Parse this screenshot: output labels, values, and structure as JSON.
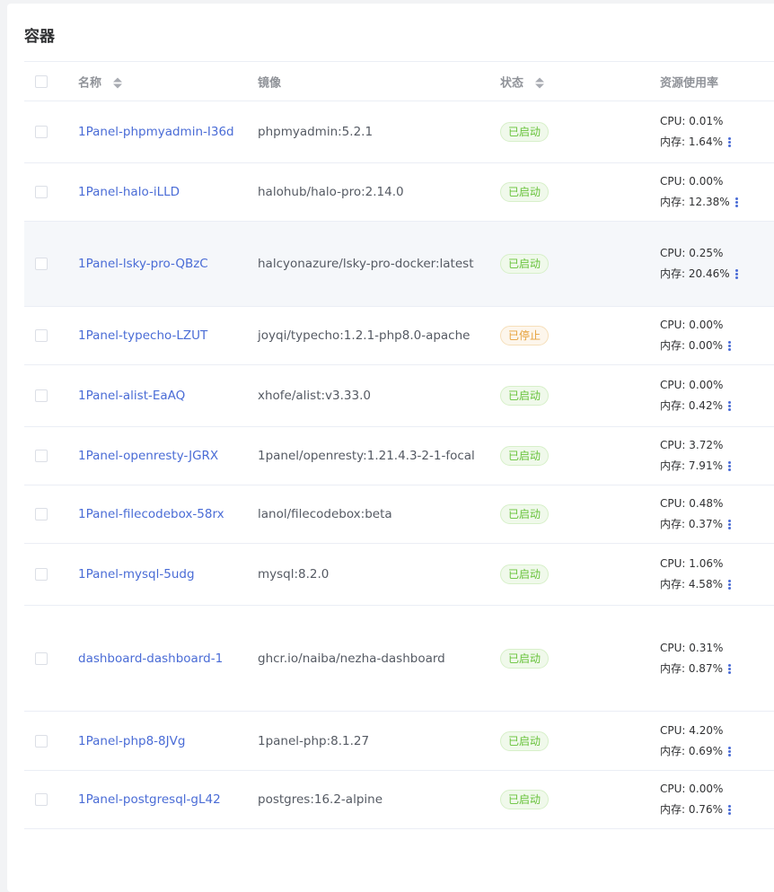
{
  "title": "容器",
  "columns": {
    "name": "名称",
    "image": "镜像",
    "status": "状态",
    "resource": "资源使用率"
  },
  "rows": [
    {
      "name": "1Panel-phpmyadmin-I36d",
      "image": "phpmyadmin:5.2.1",
      "status": "已启动",
      "status_type": "running",
      "cpu": "CPU: 0.01%",
      "mem": "内存: 1.64%"
    },
    {
      "name": "1Panel-halo-iLLD",
      "image": "halohub/halo-pro:2.14.0",
      "status": "已启动",
      "status_type": "running",
      "cpu": "CPU: 0.00%",
      "mem": "内存: 12.38%"
    },
    {
      "name": "1Panel-lsky-pro-QBzC",
      "image": "halcyonazure/lsky-pro-docker:latest",
      "status": "已启动",
      "status_type": "running",
      "cpu": "CPU: 0.25%",
      "mem": "内存: 20.46%"
    },
    {
      "name": "1Panel-typecho-LZUT",
      "image": "joyqi/typecho:1.2.1-php8.0-apache",
      "status": "已停止",
      "status_type": "stopped",
      "cpu": "CPU: 0.00%",
      "mem": "内存: 0.00%"
    },
    {
      "name": "1Panel-alist-EaAQ",
      "image": "xhofe/alist:v3.33.0",
      "status": "已启动",
      "status_type": "running",
      "cpu": "CPU: 0.00%",
      "mem": "内存: 0.42%"
    },
    {
      "name": "1Panel-openresty-JGRX",
      "image": "1panel/openresty:1.21.4.3-2-1-focal",
      "status": "已启动",
      "status_type": "running",
      "cpu": "CPU: 3.72%",
      "mem": "内存: 7.91%"
    },
    {
      "name": "1Panel-filecodebox-58rx",
      "image": "lanol/filecodebox:beta",
      "status": "已启动",
      "status_type": "running",
      "cpu": "CPU: 0.48%",
      "mem": "内存: 0.37%"
    },
    {
      "name": "1Panel-mysql-5udg",
      "image": "mysql:8.2.0",
      "status": "已启动",
      "status_type": "running",
      "cpu": "CPU: 1.06%",
      "mem": "内存: 4.58%"
    },
    {
      "name": "dashboard-dashboard-1",
      "image": "ghcr.io/naiba/nezha-dashboard",
      "status": "已启动",
      "status_type": "running",
      "cpu": "CPU: 0.31%",
      "mem": "内存: 0.87%"
    },
    {
      "name": "1Panel-php8-8JVg",
      "image": "1panel-php:8.1.27",
      "status": "已启动",
      "status_type": "running",
      "cpu": "CPU: 4.20%",
      "mem": "内存: 0.69%"
    },
    {
      "name": "1Panel-postgresql-gL42",
      "image": "postgres:16.2-alpine",
      "status": "已启动",
      "status_type": "running",
      "cpu": "CPU: 0.00%",
      "mem": "内存: 0.76%"
    }
  ]
}
